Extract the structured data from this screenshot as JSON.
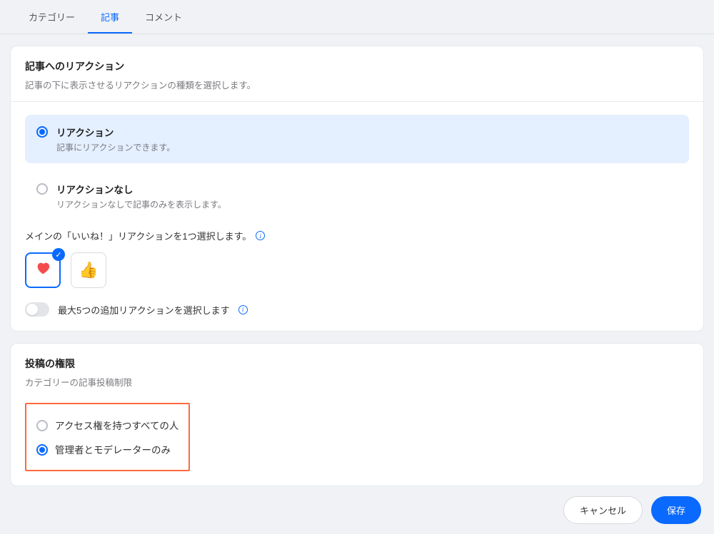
{
  "tabs": {
    "category": "カテゴリー",
    "article": "記事",
    "comment": "コメント"
  },
  "reactions": {
    "title": "記事へのリアクション",
    "subtitle": "記事の下に表示させるリアクションの種類を選択します。",
    "opt_on": {
      "title": "リアクション",
      "sub": "記事にリアクションできます。"
    },
    "opt_off": {
      "title": "リアクションなし",
      "sub": "リアクションなしで記事のみを表示します。"
    },
    "main_like_label": "メインの「いいね！」リアクションを1つ選択します。",
    "extra_toggle_label": "最大5つの追加リアクションを選択します"
  },
  "permissions": {
    "title": "投稿の権限",
    "subtitle": "カテゴリーの記事投稿制限",
    "opt_all": "アクセス権を持つすべての人",
    "opt_mods": "管理者とモデレーターのみ"
  },
  "buttons": {
    "cancel": "キャンセル",
    "save": "保存"
  }
}
